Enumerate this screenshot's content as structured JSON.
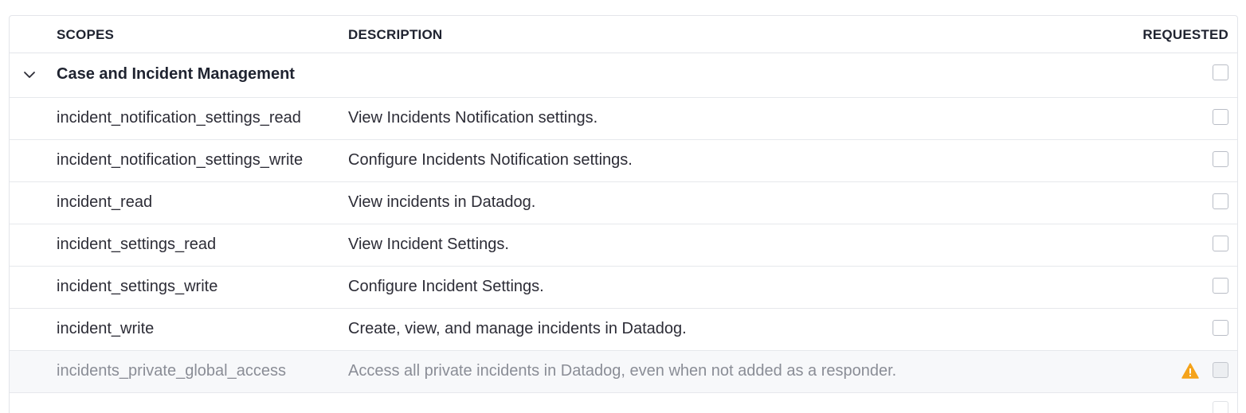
{
  "columns": {
    "scopes": "SCOPES",
    "description": "DESCRIPTION",
    "requested": "REQUESTED"
  },
  "group": {
    "label": "Case and Incident Management",
    "expanded": true,
    "requested": false,
    "icon": "chevron-down-icon"
  },
  "rows": [
    {
      "scope": "incident_notification_settings_read",
      "description": "View Incidents Notification settings.",
      "requested": false,
      "disabled": false
    },
    {
      "scope": "incident_notification_settings_write",
      "description": "Configure Incidents Notification settings.",
      "requested": false,
      "disabled": false
    },
    {
      "scope": "incident_read",
      "description": "View incidents in Datadog.",
      "requested": false,
      "disabled": false
    },
    {
      "scope": "incident_settings_read",
      "description": "View Incident Settings.",
      "requested": false,
      "disabled": false
    },
    {
      "scope": "incident_settings_write",
      "description": "Configure Incident Settings.",
      "requested": false,
      "disabled": false
    },
    {
      "scope": "incident_write",
      "description": "Create, view, and manage incidents in Datadog.",
      "requested": false,
      "disabled": false
    },
    {
      "scope": "incidents_private_global_access",
      "description": "Access all private incidents in Datadog, even when not added as a responder.",
      "requested": false,
      "disabled": true,
      "icon": "warning-icon"
    }
  ],
  "colors": {
    "warning": "#f5a31a",
    "border": "#e3e5ea",
    "disabled_text": "#8a8d96"
  }
}
